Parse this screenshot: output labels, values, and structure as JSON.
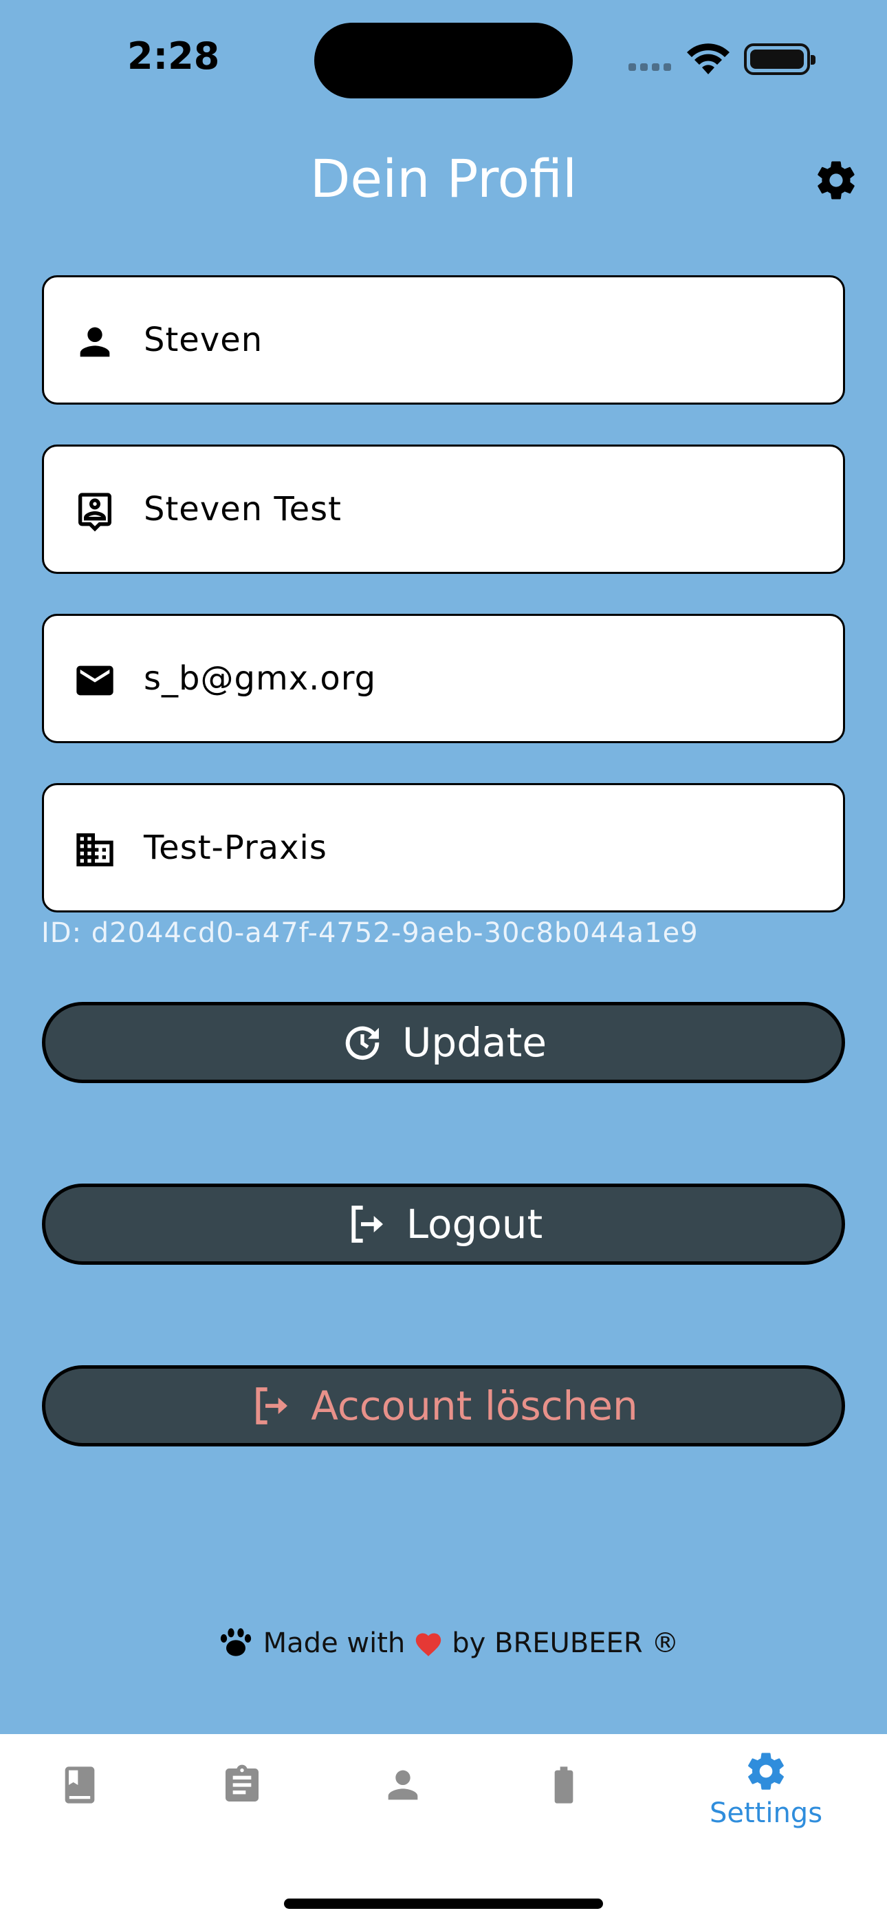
{
  "status": {
    "time": "2:28"
  },
  "header": {
    "title": "Dein Profil"
  },
  "fields": [
    {
      "icon": "person-icon",
      "value": "Steven"
    },
    {
      "icon": "contact-badge-icon",
      "value": "Steven Test"
    },
    {
      "icon": "mail-icon",
      "value": "s_b@gmx.org"
    },
    {
      "icon": "building-icon",
      "value": "Test-Praxis"
    }
  ],
  "user_id": "ID: d2044cd0-a47f-4752-9aeb-30c8b044a1e9",
  "buttons": {
    "update": "Update",
    "logout": "Logout",
    "delete": "Account löschen"
  },
  "footer": {
    "made_with": "Made with",
    "by": "by BREUBEER ®"
  },
  "nav": {
    "settings_label": "Settings",
    "active_color": "#2f8ddc",
    "inactive_color": "#8e8e8e"
  },
  "colors": {
    "background": "#7ab4e0",
    "button": "#37474f",
    "danger_text": "#e8918a"
  }
}
